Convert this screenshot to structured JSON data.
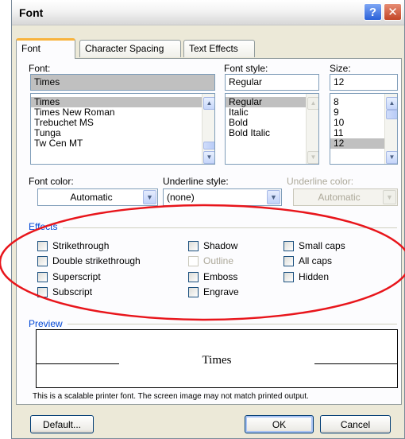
{
  "window": {
    "title": "Font",
    "help_symbol": "?",
    "close_symbol": "✕"
  },
  "tabs": [
    {
      "label": "Font",
      "active": true
    },
    {
      "label": "Character Spacing",
      "active": false
    },
    {
      "label": "Text Effects",
      "active": false
    }
  ],
  "font": {
    "label": "Font:",
    "value": "Times",
    "items": [
      "Times",
      "Times New Roman",
      "Trebuchet MS",
      "Tunga",
      "Tw Cen MT"
    ],
    "selected": "Times"
  },
  "font_style": {
    "label": "Font style:",
    "value": "Regular",
    "items": [
      "Regular",
      "Italic",
      "Bold",
      "Bold Italic"
    ],
    "selected": "Regular"
  },
  "size": {
    "label": "Size:",
    "value": "12",
    "items": [
      "8",
      "9",
      "10",
      "11",
      "12"
    ],
    "selected": "12"
  },
  "font_color": {
    "label": "Font color:",
    "value": "Automatic"
  },
  "underline_style": {
    "label": "Underline style:",
    "value": "(none)"
  },
  "underline_color": {
    "label": "Underline color:",
    "value": "Automatic",
    "disabled": true
  },
  "effects": {
    "label": "Effects",
    "col1": [
      "Strikethrough",
      "Double strikethrough",
      "Superscript",
      "Subscript"
    ],
    "col2": [
      "Shadow",
      "Outline",
      "Emboss",
      "Engrave"
    ],
    "col3": [
      "Small caps",
      "All caps",
      "Hidden"
    ],
    "disabled": [
      "Outline"
    ]
  },
  "preview": {
    "label": "Preview",
    "sample_text": "Times",
    "note": "This is a scalable printer font. The screen image may not match printed output."
  },
  "buttons": {
    "default": "Default...",
    "ok": "OK",
    "cancel": "Cancel"
  },
  "annotation": {
    "color": "#e8151b"
  }
}
